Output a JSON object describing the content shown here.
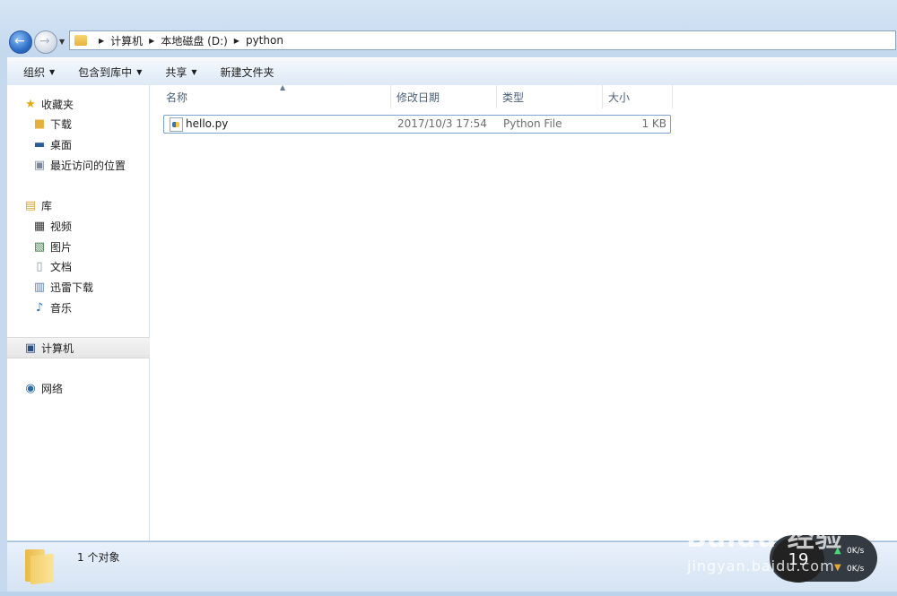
{
  "address": {
    "crumbs": [
      "计算机",
      "本地磁盘 (D:)",
      "python"
    ]
  },
  "toolbar": {
    "organize": "组织",
    "include_library": "包含到库中",
    "share": "共享",
    "new_folder": "新建文件夹"
  },
  "nav": {
    "favorites": "收藏夹",
    "downloads": "下载",
    "desktop": "桌面",
    "recent": "最近访问的位置",
    "libraries": "库",
    "videos": "视频",
    "pictures": "图片",
    "documents": "文档",
    "xunlei": "迅雷下载",
    "music": "音乐",
    "computer": "计算机",
    "network": "网络"
  },
  "columns": {
    "name": "名称",
    "modified": "修改日期",
    "type": "类型",
    "size": "大小"
  },
  "files": [
    {
      "name": "hello.py",
      "modified": "2017/10/3 17:54",
      "type": "Python File",
      "size": "1 KB"
    }
  ],
  "status": {
    "count": "1 个对象"
  },
  "overlay": {
    "watermark": "Baidu 经验",
    "watermark_sub": "jingyan.baidu.com",
    "speed_value": "19",
    "upload": "0K/s",
    "download": "0K/s"
  },
  "colors": {
    "accent": "#2d6ec8",
    "selection_border": "#7da2ce"
  }
}
